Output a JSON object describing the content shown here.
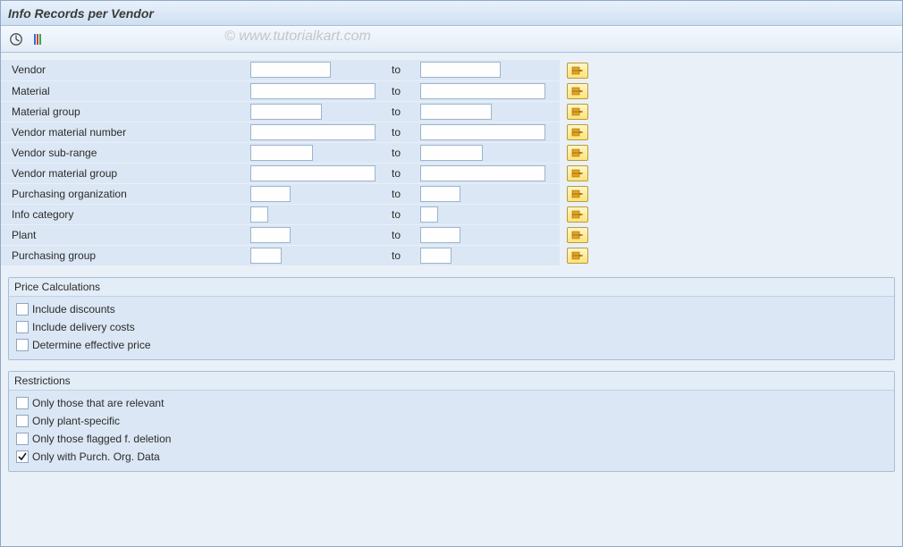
{
  "window_title": "Info Records per Vendor",
  "watermark": "© www.tutorialkart.com",
  "selection_rows": [
    {
      "id": "vendor",
      "label": "Vendor",
      "from_w": 90,
      "to_w": 90
    },
    {
      "id": "material",
      "label": "Material",
      "from_w": 140,
      "to_w": 140
    },
    {
      "id": "material-group",
      "label": "Material group",
      "from_w": 80,
      "to_w": 80
    },
    {
      "id": "vend-mat-no",
      "label": "Vendor material number",
      "from_w": 140,
      "to_w": 140
    },
    {
      "id": "vend-subrange",
      "label": "Vendor sub-range",
      "from_w": 70,
      "to_w": 70
    },
    {
      "id": "vend-mat-group",
      "label": "Vendor material group",
      "from_w": 140,
      "to_w": 140
    },
    {
      "id": "purch-org",
      "label": "Purchasing organization",
      "from_w": 45,
      "to_w": 45
    },
    {
      "id": "info-category",
      "label": "Info category",
      "from_w": 20,
      "to_w": 20
    },
    {
      "id": "plant",
      "label": "Plant",
      "from_w": 45,
      "to_w": 45
    },
    {
      "id": "purch-group",
      "label": "Purchasing group",
      "from_w": 35,
      "to_w": 35
    }
  ],
  "to_label": "to",
  "groups": [
    {
      "id": "price-calc",
      "title": "Price Calculations",
      "checks": [
        {
          "id": "include-discounts",
          "label": "Include discounts",
          "checked": false
        },
        {
          "id": "include-delivery-costs",
          "label": "Include delivery costs",
          "checked": false
        },
        {
          "id": "determine-eff-price",
          "label": "Determine effective price",
          "checked": false
        }
      ]
    },
    {
      "id": "restrictions",
      "title": "Restrictions",
      "checks": [
        {
          "id": "only-relevant",
          "label": "Only those that are relevant",
          "checked": false
        },
        {
          "id": "only-plant-specific",
          "label": "Only plant-specific",
          "checked": false
        },
        {
          "id": "only-flagged-deletion",
          "label": "Only those flagged f. deletion",
          "checked": false
        },
        {
          "id": "only-purch-org-data",
          "label": "Only with Purch. Org. Data",
          "checked": true
        }
      ]
    }
  ]
}
